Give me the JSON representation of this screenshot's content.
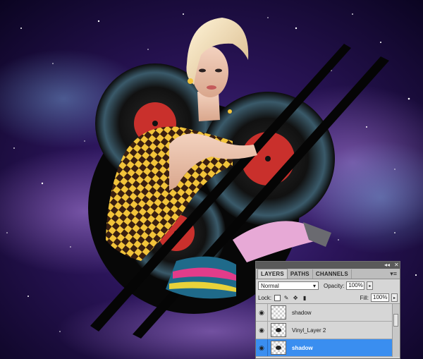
{
  "panel": {
    "tabs": [
      {
        "label": "LAYERS",
        "active": true
      },
      {
        "label": "PATHS",
        "active": false
      },
      {
        "label": "CHANNELS",
        "active": false
      }
    ],
    "blend_mode": "Normal",
    "opacity_label": "Opacity:",
    "opacity_value": "100%",
    "lock_label": "Lock:",
    "fill_label": "Fill:",
    "fill_value": "100%",
    "layers": [
      {
        "name": "shadow",
        "selected": false
      },
      {
        "name": "Vinyl_Layer 2",
        "selected": false
      },
      {
        "name": "shadow",
        "selected": true
      }
    ]
  },
  "colors": {
    "selection": "#3a8ef0",
    "record_label_red": "#c9302c",
    "panel_bg": "#d6d6d6"
  }
}
